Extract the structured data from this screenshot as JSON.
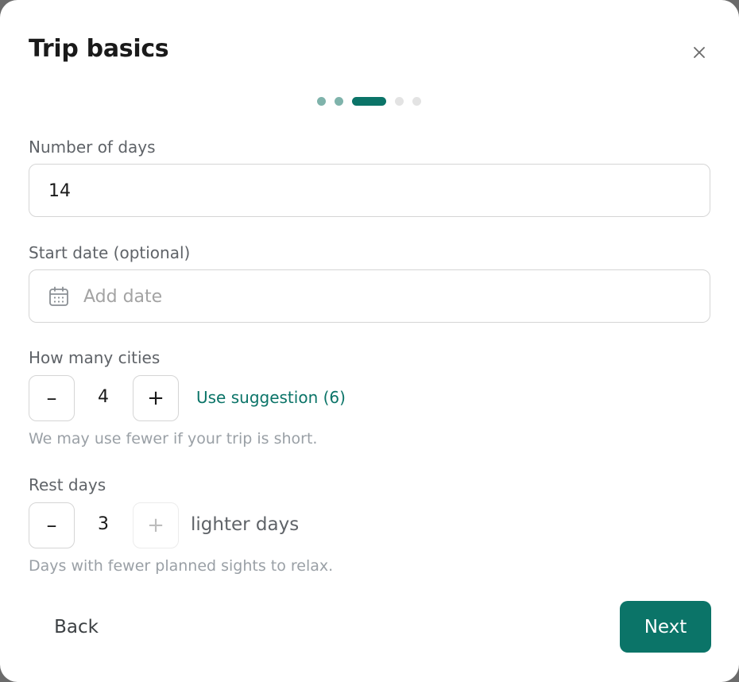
{
  "dialog": {
    "title": "Trip basics",
    "close_icon": "close-icon"
  },
  "progress": {
    "total_steps": 5,
    "current_step": 3,
    "completed_color": "#7fb3ab",
    "active_color": "#0b7468",
    "todo_color": "#e3e3e3"
  },
  "days": {
    "label": "Number of days",
    "value": "14"
  },
  "start_date": {
    "label": "Start date (optional)",
    "placeholder": "Add date",
    "icon": "calendar-icon"
  },
  "cities": {
    "label": "How many cities",
    "minus_label": "–",
    "plus_label": "+",
    "value": "4",
    "suggestion": "Use suggestion (6)",
    "hint": "We may use fewer if your trip is short."
  },
  "rest": {
    "label": "Rest days",
    "minus_label": "–",
    "plus_label": "+",
    "value": "3",
    "suffix": "lighter days",
    "hint": "Days with fewer planned sights to relax."
  },
  "footer": {
    "back_label": "Back",
    "next_label": "Next"
  },
  "colors": {
    "accent": "#0b7468"
  }
}
